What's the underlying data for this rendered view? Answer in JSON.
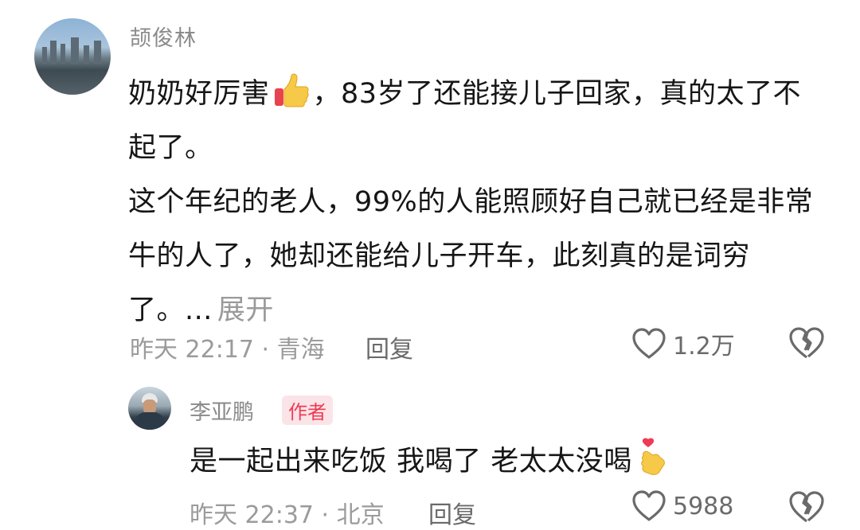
{
  "comment": {
    "username": "颉俊林",
    "line1_before_emoji": "奶奶好厉害",
    "line1_after_emoji": "，83岁了还能接儿子回家，真的太了不起了。",
    "paragraph2": "这个年纪的老人，99%的人能照顾好自己就已经是非常牛的人了，她却还能给儿子开车，此刻真的是词穷了。...",
    "expand_label": "展开",
    "meta": "昨天 22:17 · 青海",
    "reply_label": "回复",
    "like_count": "1.2万"
  },
  "reply": {
    "username": "李亚鹏",
    "badge": "作者",
    "text": "是一起出来吃饭 我喝了 老太太没喝",
    "meta": "昨天 22:37 · 北京",
    "reply_label": "回复",
    "like_count": "5988"
  },
  "icons": {
    "thumb_emoji": "thumbs-up-emoji",
    "heart_emoji": "finger-heart-emoji",
    "like": "heart-outline-icon",
    "dislike": "broken-heart-icon"
  }
}
